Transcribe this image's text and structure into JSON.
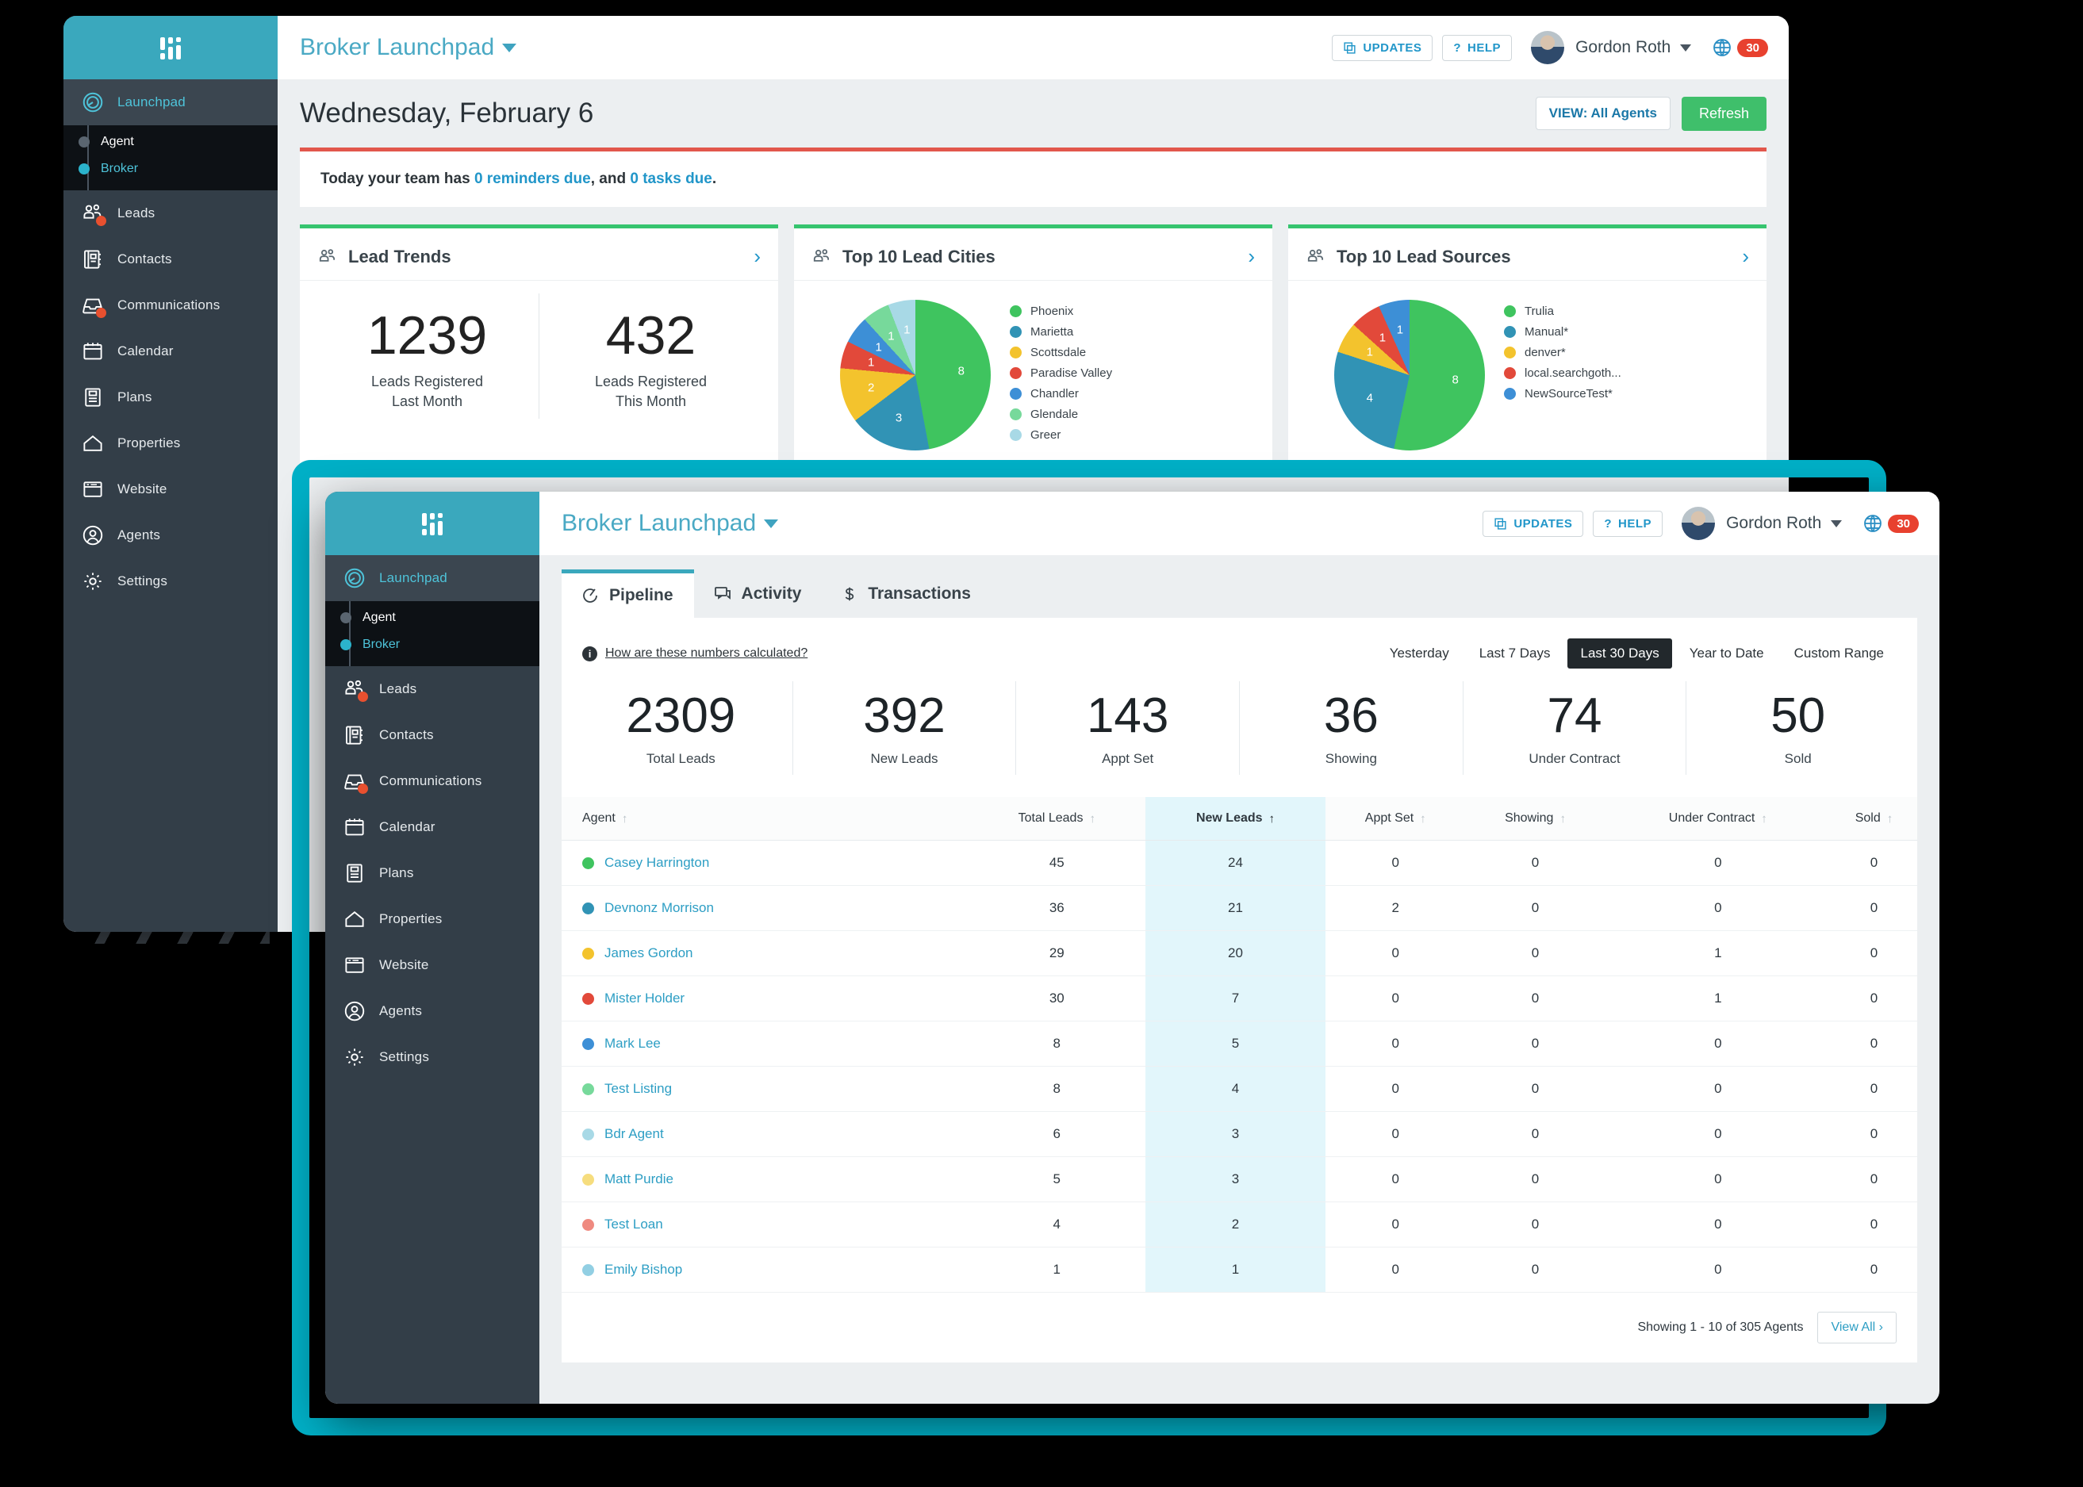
{
  "brand": {
    "accent": "#3aa8bd",
    "teal_frame": "#00b0c7",
    "green": "#36c46f",
    "red": "#e2574c"
  },
  "sidebar": {
    "logo_name": "app-logo",
    "items": [
      {
        "label": "Launchpad",
        "icon": "launchpad-icon",
        "active": true
      },
      {
        "label": "Leads",
        "icon": "leads-icon",
        "badge": true
      },
      {
        "label": "Contacts",
        "icon": "contacts-icon",
        "badge": false
      },
      {
        "label": "Communications",
        "icon": "communications-icon",
        "badge": true
      },
      {
        "label": "Calendar",
        "icon": "calendar-icon",
        "badge": false
      },
      {
        "label": "Plans",
        "icon": "plans-icon",
        "badge": false
      },
      {
        "label": "Properties",
        "icon": "properties-icon",
        "badge": false
      },
      {
        "label": "Website",
        "icon": "website-icon",
        "badge": false
      },
      {
        "label": "Agents",
        "icon": "agents-icon",
        "badge": false
      },
      {
        "label": "Settings",
        "icon": "settings-icon",
        "badge": false
      }
    ],
    "sub_items": [
      {
        "label": "Agent",
        "selected": false
      },
      {
        "label": "Broker",
        "selected": true
      }
    ]
  },
  "topbar": {
    "app_title": "Broker Launchpad",
    "updates_label": "UPDATES",
    "help_label": "HELP",
    "help_glyph": "?",
    "user_name": "Gordon Roth",
    "notification_count": "30"
  },
  "back_window": {
    "date_title": "Wednesday, February 6",
    "view_button": "VIEW: All Agents",
    "refresh_button": "Refresh",
    "notice": {
      "prefix": "Today your team has ",
      "link1": "0 reminders due",
      "middle": ", and ",
      "link2": "0 tasks due",
      "suffix": "."
    },
    "lead_trends": {
      "title": "Lead Trends",
      "stats": [
        {
          "value": "1239",
          "label_line1": "Leads Registered",
          "label_line2": "Last Month"
        },
        {
          "value": "432",
          "label_line1": "Leads Registered",
          "label_line2": "This Month"
        }
      ]
    },
    "lead_cities": {
      "title": "Top 10 Lead Cities"
    },
    "lead_sources": {
      "title": "Top 10 Lead Sources"
    }
  },
  "chart_data": [
    {
      "type": "pie",
      "title": "Top 10 Lead Cities",
      "legend_position": "right",
      "categories": [
        "Phoenix",
        "Marietta",
        "Scottsdale",
        "Paradise Valley",
        "Chandler",
        "Glendale",
        "Greer"
      ],
      "values": [
        8,
        3,
        2,
        1,
        1,
        1,
        1
      ],
      "colors": [
        "#3fc45f",
        "#3193b5",
        "#f3c32d",
        "#e2493a",
        "#3d8fd6",
        "#77d99b",
        "#a8d9e6"
      ],
      "data_labels": [
        "8",
        "3",
        "2",
        "1",
        "1",
        "1",
        "1"
      ]
    },
    {
      "type": "pie",
      "title": "Top 10 Lead Sources",
      "legend_position": "right",
      "categories": [
        "Trulia",
        "Manual*",
        "denver*",
        "local.searchgoth...",
        "NewSourceTest*"
      ],
      "values": [
        8,
        4,
        1,
        1,
        1
      ],
      "colors": [
        "#3fc45f",
        "#3193b5",
        "#f3c32d",
        "#e2493a",
        "#3d8fd6"
      ],
      "data_labels": [
        "8",
        "4",
        "1",
        "1",
        "1"
      ]
    }
  ],
  "front_window": {
    "tabs": [
      {
        "label": "Pipeline",
        "icon": "pipeline-icon",
        "active": true
      },
      {
        "label": "Activity",
        "icon": "activity-icon",
        "active": false
      },
      {
        "label": "Transactions",
        "icon": "dollar-icon",
        "active": false
      }
    ],
    "calc_link": "How are these numbers calculated?",
    "ranges": [
      {
        "label": "Yesterday",
        "active": false
      },
      {
        "label": "Last 7 Days",
        "active": false
      },
      {
        "label": "Last 30 Days",
        "active": true
      },
      {
        "label": "Year to Date",
        "active": false
      },
      {
        "label": "Custom Range",
        "active": false
      }
    ],
    "kpis": [
      {
        "value": "2309",
        "label": "Total Leads"
      },
      {
        "value": "392",
        "label": "New Leads"
      },
      {
        "value": "143",
        "label": "Appt Set"
      },
      {
        "value": "36",
        "label": "Showing"
      },
      {
        "value": "74",
        "label": "Under Contract"
      },
      {
        "value": "50",
        "label": "Sold"
      }
    ],
    "table": {
      "columns": [
        {
          "label": "Agent",
          "sorted": false,
          "highlighted": false
        },
        {
          "label": "Total Leads",
          "sorted": false,
          "highlighted": false
        },
        {
          "label": "New Leads",
          "sorted": true,
          "highlighted": true
        },
        {
          "label": "Appt Set",
          "sorted": false,
          "highlighted": false
        },
        {
          "label": "Showing",
          "sorted": false,
          "highlighted": false
        },
        {
          "label": "Under Contract",
          "sorted": false,
          "highlighted": false
        },
        {
          "label": "Sold",
          "sorted": false,
          "highlighted": false
        }
      ],
      "rows": [
        {
          "agent": "Casey Harrington",
          "color": "#3fc45f",
          "total_leads": "45",
          "new_leads": "24",
          "appt_set": "0",
          "showing": "0",
          "under_contract": "0",
          "sold": "0"
        },
        {
          "agent": "Devnonz Morrison",
          "color": "#3193b5",
          "total_leads": "36",
          "new_leads": "21",
          "appt_set": "2",
          "showing": "0",
          "under_contract": "0",
          "sold": "0"
        },
        {
          "agent": "James Gordon",
          "color": "#f3c32d",
          "total_leads": "29",
          "new_leads": "20",
          "appt_set": "0",
          "showing": "0",
          "under_contract": "1",
          "sold": "0"
        },
        {
          "agent": "Mister Holder",
          "color": "#e2493a",
          "total_leads": "30",
          "new_leads": "7",
          "appt_set": "0",
          "showing": "0",
          "under_contract": "1",
          "sold": "0"
        },
        {
          "agent": "Mark Lee",
          "color": "#3d8fd6",
          "total_leads": "8",
          "new_leads": "5",
          "appt_set": "0",
          "showing": "0",
          "under_contract": "0",
          "sold": "0"
        },
        {
          "agent": "Test Listing",
          "color": "#77d99b",
          "total_leads": "8",
          "new_leads": "4",
          "appt_set": "0",
          "showing": "0",
          "under_contract": "0",
          "sold": "0"
        },
        {
          "agent": "Bdr Agent",
          "color": "#a8d9e6",
          "total_leads": "6",
          "new_leads": "3",
          "appt_set": "0",
          "showing": "0",
          "under_contract": "0",
          "sold": "0"
        },
        {
          "agent": "Matt Purdie",
          "color": "#f6dd7e",
          "total_leads": "5",
          "new_leads": "3",
          "appt_set": "0",
          "showing": "0",
          "under_contract": "0",
          "sold": "0"
        },
        {
          "agent": "Test Loan",
          "color": "#ef8a80",
          "total_leads": "4",
          "new_leads": "2",
          "appt_set": "0",
          "showing": "0",
          "under_contract": "0",
          "sold": "0"
        },
        {
          "agent": "Emily Bishop",
          "color": "#92cfe3",
          "total_leads": "1",
          "new_leads": "1",
          "appt_set": "0",
          "showing": "0",
          "under_contract": "0",
          "sold": "0"
        }
      ],
      "footer_text": "Showing 1 - 10 of 305 Agents",
      "view_all": "View All ›"
    }
  }
}
